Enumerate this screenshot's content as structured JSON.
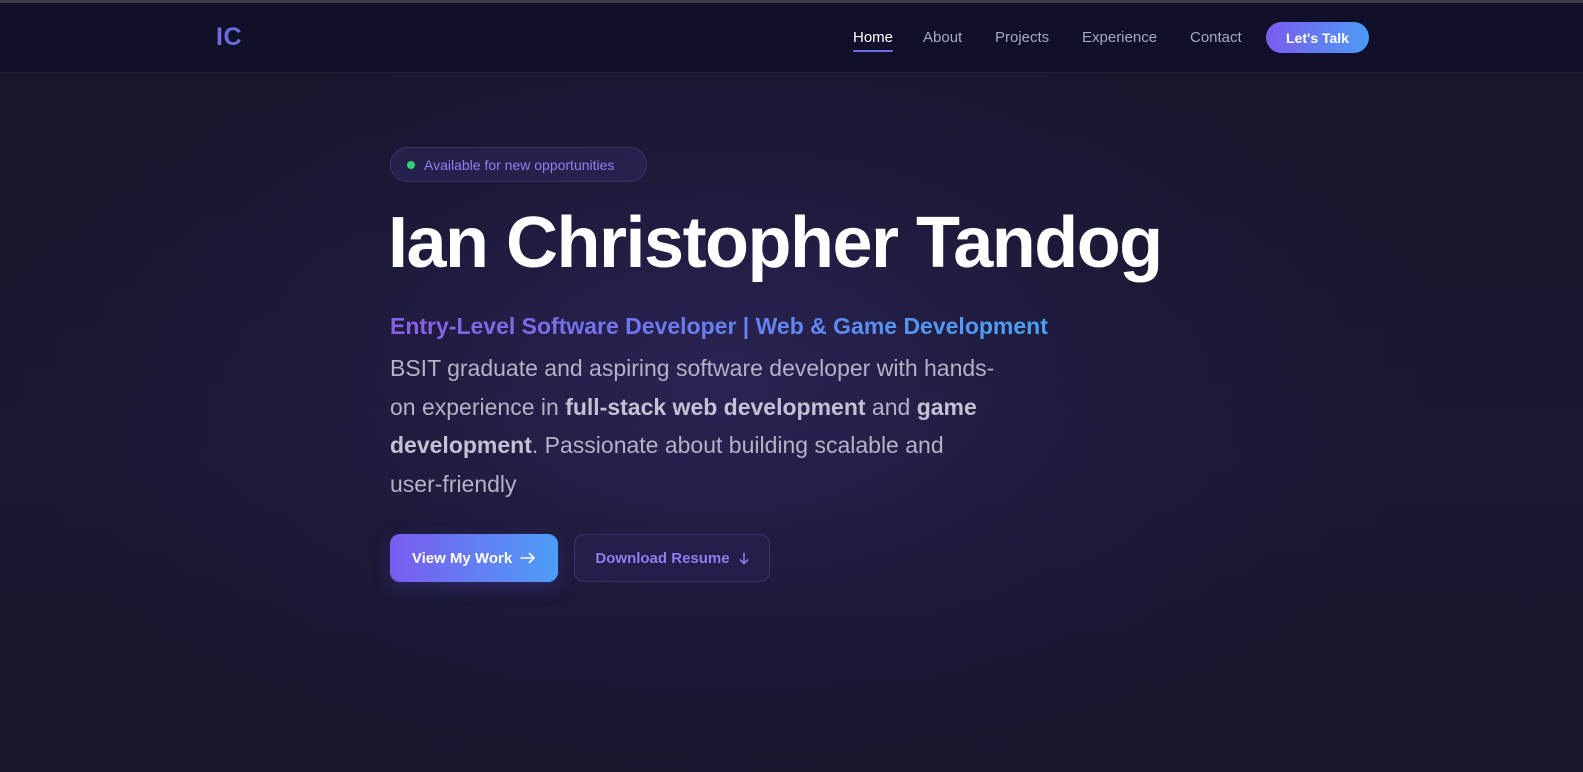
{
  "nav": {
    "logo": "IC",
    "links": [
      {
        "label": "Home",
        "active": true
      },
      {
        "label": "About",
        "active": false
      },
      {
        "label": "Projects",
        "active": false
      },
      {
        "label": "Experience",
        "active": false
      },
      {
        "label": "Contact",
        "active": false
      }
    ],
    "cta_label": "Let's Talk"
  },
  "hero": {
    "badge": "Available for new opportunities",
    "name": "Ian Christopher Tandog",
    "role": "Entry-Level Software Developer | Web & Game Development",
    "description": {
      "part1": "BSIT graduate and aspiring software developer with hands-on experience in ",
      "bold1": "full-stack web development",
      "part2": " and ",
      "bold2": "game development",
      "part3": ". Passionate about building scalable and user-friendly"
    },
    "primary_button": "View My Work",
    "secondary_button": "Download Resume"
  },
  "icons": {
    "primary_button_icon": "arrow-right-icon",
    "secondary_button_icon": "arrow-down-icon",
    "badge_icon": "status-dot-icon"
  },
  "colors": {
    "accent_purple": "#7a5cf0",
    "accent_blue": "#4d9bf5",
    "status_green": "#2fd07a",
    "background": "#16162b"
  }
}
